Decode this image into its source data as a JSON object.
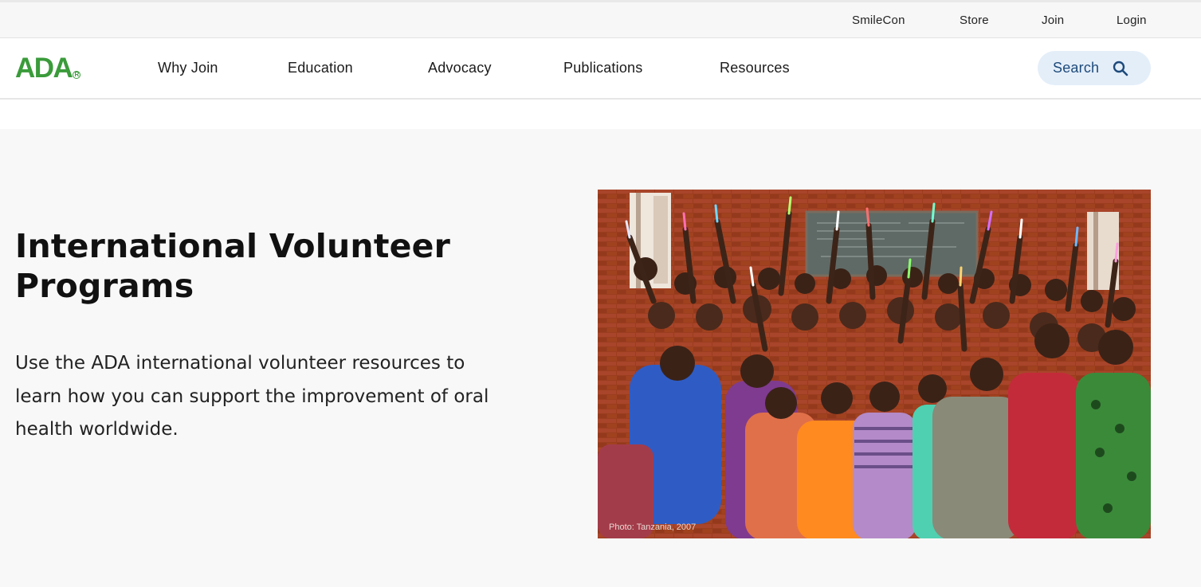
{
  "utility_nav": {
    "items": [
      "SmileCon",
      "Store",
      "Join",
      "Login"
    ]
  },
  "header": {
    "logo_text": "ADA",
    "nav": [
      "Why Join",
      "Education",
      "Advocacy",
      "Publications",
      "Resources"
    ],
    "search_label": "Search"
  },
  "hero": {
    "title": "International Volunteer Programs",
    "description": "Use the ADA international volunteer resources to learn how you can support the improvement of oral health worldwide.",
    "photo_caption": "Photo: Tanzania, 2007"
  },
  "colors": {
    "brand_green": "#3a9b3a",
    "search_bg": "#e4eef9",
    "search_text": "#1d4a7a",
    "hero_bg": "#f8f8f8"
  }
}
